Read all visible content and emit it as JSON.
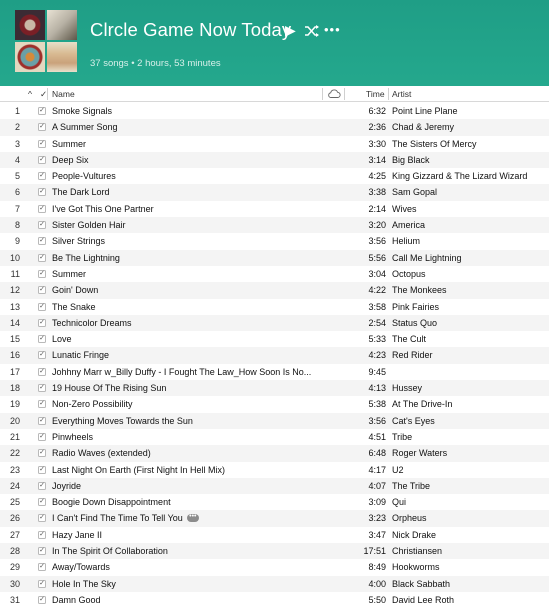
{
  "header": {
    "title": "Clrcle Game Now Today",
    "subtitle": "37 songs • 2 hours, 53 minutes",
    "play_icon": "play-icon",
    "shuffle_icon": "shuffle-icon",
    "more_icon": "more-icon",
    "more_label": "•••",
    "play_glyph": "▶"
  },
  "colors": {
    "header_bg": "#22a48a",
    "row_alt": "#f4f4f4"
  },
  "table": {
    "columns": {
      "sort": "^",
      "check": "✓",
      "name": "Name",
      "time": "Time",
      "artist": "Artist"
    },
    "rows": [
      {
        "num": "1",
        "name": "Smoke Signals",
        "time": "6:32",
        "artist": "Point Line Plane"
      },
      {
        "num": "2",
        "name": "A Summer Song",
        "time": "2:36",
        "artist": "Chad & Jeremy"
      },
      {
        "num": "3",
        "name": "Summer",
        "time": "3:30",
        "artist": "The Sisters Of Mercy"
      },
      {
        "num": "4",
        "name": "Deep Six",
        "time": "3:14",
        "artist": "Big Black"
      },
      {
        "num": "5",
        "name": "People-Vultures",
        "time": "4:25",
        "artist": "King Gizzard & The Lizard Wizard"
      },
      {
        "num": "6",
        "name": "The Dark Lord",
        "time": "3:38",
        "artist": "Sam Gopal"
      },
      {
        "num": "7",
        "name": "I've Got This One Partner",
        "time": "2:14",
        "artist": "Wives"
      },
      {
        "num": "8",
        "name": "Sister Golden Hair",
        "time": "3:20",
        "artist": "America"
      },
      {
        "num": "9",
        "name": "Silver Strings",
        "time": "3:56",
        "artist": "Helium"
      },
      {
        "num": "10",
        "name": "Be The Lightning",
        "time": "5:56",
        "artist": "Call Me Lightning"
      },
      {
        "num": "11",
        "name": "Summer",
        "time": "3:04",
        "artist": "Octopus"
      },
      {
        "num": "12",
        "name": "Goin' Down",
        "time": "4:22",
        "artist": "The Monkees"
      },
      {
        "num": "13",
        "name": "The Snake",
        "time": "3:58",
        "artist": "Pink Fairies"
      },
      {
        "num": "14",
        "name": "Technicolor Dreams",
        "time": "2:54",
        "artist": "Status Quo"
      },
      {
        "num": "15",
        "name": "Love",
        "time": "5:33",
        "artist": "The Cult"
      },
      {
        "num": "16",
        "name": "Lunatic Fringe",
        "time": "4:23",
        "artist": "Red Rider"
      },
      {
        "num": "17",
        "name": "Johhny Marr w_Billy Duffy - I Fought The Law_How Soon Is No...",
        "time": "9:45",
        "artist": ""
      },
      {
        "num": "18",
        "name": "19  House Of The Rising Sun",
        "time": "4:13",
        "artist": "Hussey"
      },
      {
        "num": "19",
        "name": "Non-Zero Possibility",
        "time": "5:38",
        "artist": "At The Drive-In"
      },
      {
        "num": "20",
        "name": "Everything Moves Towards the Sun",
        "time": "3:56",
        "artist": "Cat's Eyes"
      },
      {
        "num": "21",
        "name": "Pinwheels",
        "time": "4:51",
        "artist": "Tribe"
      },
      {
        "num": "22",
        "name": "Radio Waves (extended)",
        "time": "6:48",
        "artist": "Roger Waters"
      },
      {
        "num": "23",
        "name": "Last Night On Earth (First Night In Hell Mix)",
        "time": "4:17",
        "artist": "U2"
      },
      {
        "num": "24",
        "name": "Joyride",
        "time": "4:07",
        "artist": "The Tribe"
      },
      {
        "num": "25",
        "name": "Boogie Down Disappointment",
        "time": "3:09",
        "artist": "Qui"
      },
      {
        "num": "26",
        "name": "I Can't Find The Time To Tell You",
        "time": "3:23",
        "artist": "Orpheus",
        "has_more": true
      },
      {
        "num": "27",
        "name": "Hazy Jane II",
        "time": "3:47",
        "artist": "Nick Drake"
      },
      {
        "num": "28",
        "name": "In The Spirit Of Collaboration",
        "time": "17:51",
        "artist": "Christiansen"
      },
      {
        "num": "29",
        "name": "Away/Towards",
        "time": "8:49",
        "artist": "Hookworms"
      },
      {
        "num": "30",
        "name": "Hole In The Sky",
        "time": "4:00",
        "artist": "Black Sabbath"
      },
      {
        "num": "31",
        "name": "Damn Good",
        "time": "5:50",
        "artist": "David Lee Roth"
      }
    ]
  }
}
